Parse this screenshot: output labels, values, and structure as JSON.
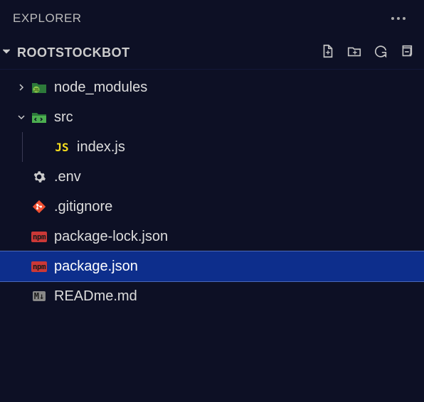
{
  "header": {
    "title": "EXPLORER"
  },
  "project": {
    "name": "ROOTSTOCKBOT"
  },
  "tree": {
    "node_modules": "node_modules",
    "src": "src",
    "index_js": "index.js",
    "env": ".env",
    "gitignore": ".gitignore",
    "package_lock": "package-lock.json",
    "package_json": "package.json",
    "readme": "READme.md"
  },
  "icon_labels": {
    "js": "JS",
    "npm": "npm",
    "md": "M↓"
  }
}
